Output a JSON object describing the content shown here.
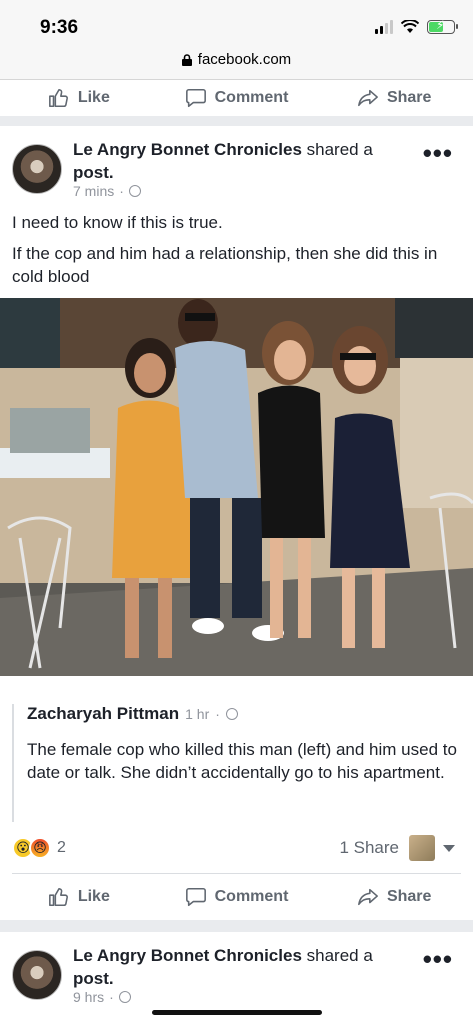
{
  "status_bar": {
    "time": "9:36"
  },
  "browser": {
    "url": "facebook.com"
  },
  "actions": {
    "like": "Like",
    "comment": "Comment",
    "share": "Share"
  },
  "post1": {
    "page_name": "Le Angry Bonnet Chronicles",
    "shared_text": "shared a",
    "shared_text2": "post.",
    "time": "7 mins",
    "text_line1": "I need to know if this is true.",
    "text_line2": "If the cop and him had a relationship, then she did this in cold blood",
    "shared_post": {
      "author": "Zacharyah Pittman",
      "time": "1 hr",
      "text": "The female cop who killed this man (left) and him used to date or talk. She didn’t accidentally go to his apartment."
    },
    "reaction_count": "2",
    "share_count": "1 Share"
  },
  "post2": {
    "page_name": "Le Angry Bonnet Chronicles",
    "shared_text": "shared a",
    "shared_text2": "post.",
    "time": "9 hrs"
  },
  "colors": {
    "link_blue": "#385898",
    "meta_gray": "#90949c",
    "action_gray": "#606770"
  }
}
